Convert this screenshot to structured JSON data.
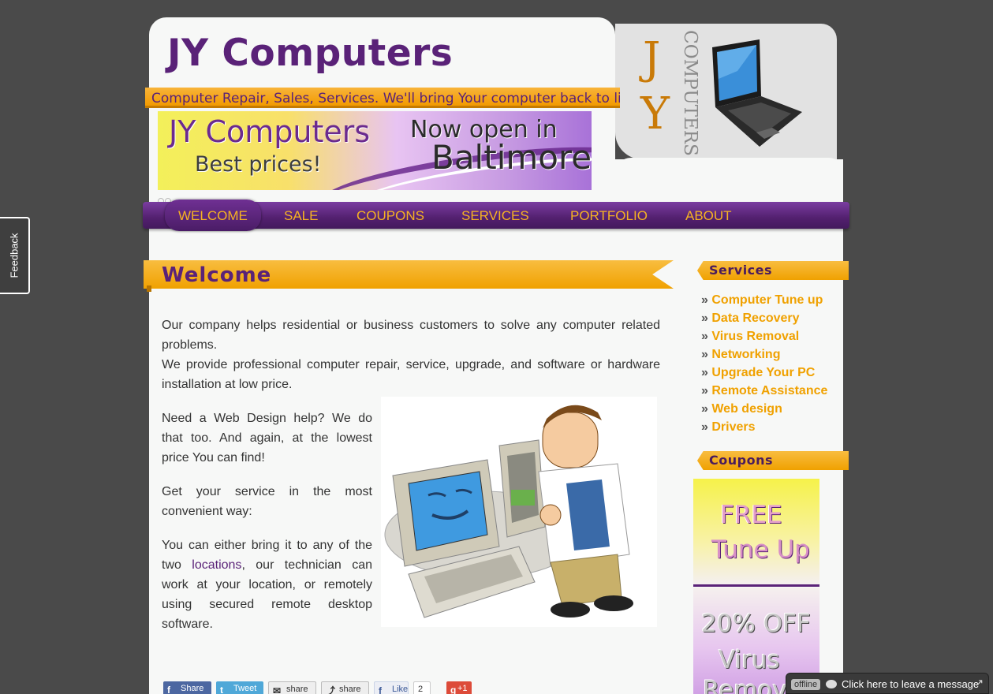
{
  "feedback": {
    "label": "Feedback"
  },
  "header": {
    "site_title": "JY Computers",
    "tagline": "Computer Repair, Sales, Services. We'll bring Your computer back to life!",
    "logo_letters": [
      "J",
      "Y"
    ],
    "logo_vertical_text": "COMPUTERS"
  },
  "banner": {
    "title": "JY Computers",
    "subtitle": "Best prices!",
    "open_line": "Now open in",
    "city": "Baltimore!"
  },
  "nav": {
    "items": [
      {
        "label": "WELCOME",
        "active": true
      },
      {
        "label": "SALE"
      },
      {
        "label": "COUPONS"
      },
      {
        "label": "SERVICES"
      },
      {
        "label": "PORTFOLIO"
      },
      {
        "label": "ABOUT"
      }
    ]
  },
  "main": {
    "heading": "Welcome",
    "intro_1": "Our company helps residential or business customers to solve any computer related problems.",
    "intro_2": "We provide professional computer repair, service, upgrade, and software or hardware installation  at low price.",
    "web_design": "Need a Web Design help? We do that too. And again, at the lowest price You can find!",
    "convenient": "Get your service in the most convenient way:",
    "bring_before": "You can either bring it to any of the two ",
    "locations_link": "locations",
    "bring_after": ",  our technician can work at your location, or remotely using secured remote desktop software."
  },
  "social": {
    "facebook": "Share",
    "twitter": "Tweet",
    "email": "share",
    "share": "share",
    "like": "Like",
    "like_count": "2",
    "gplus": "+1"
  },
  "sidebar": {
    "services_heading": "Services",
    "services": [
      "Computer Tune up",
      "Data Recovery",
      "Virus Removal",
      "Networking",
      "Upgrade Your PC",
      "Remote Assistance",
      "Web design",
      "Drivers"
    ],
    "bullet": "»",
    "coupons_heading": "Coupons",
    "coupon_1": {
      "line1": "FREE",
      "line2": "Tune Up"
    },
    "coupon_2": {
      "line1": "20% OFF",
      "line2": "Virus",
      "line3": "Remov"
    }
  },
  "chat": {
    "status": "offline",
    "message": "Click here to leave a message"
  },
  "colors": {
    "brand_purple": "#5a2278",
    "accent_orange": "#f0a100",
    "background": "#4a4a4a"
  }
}
